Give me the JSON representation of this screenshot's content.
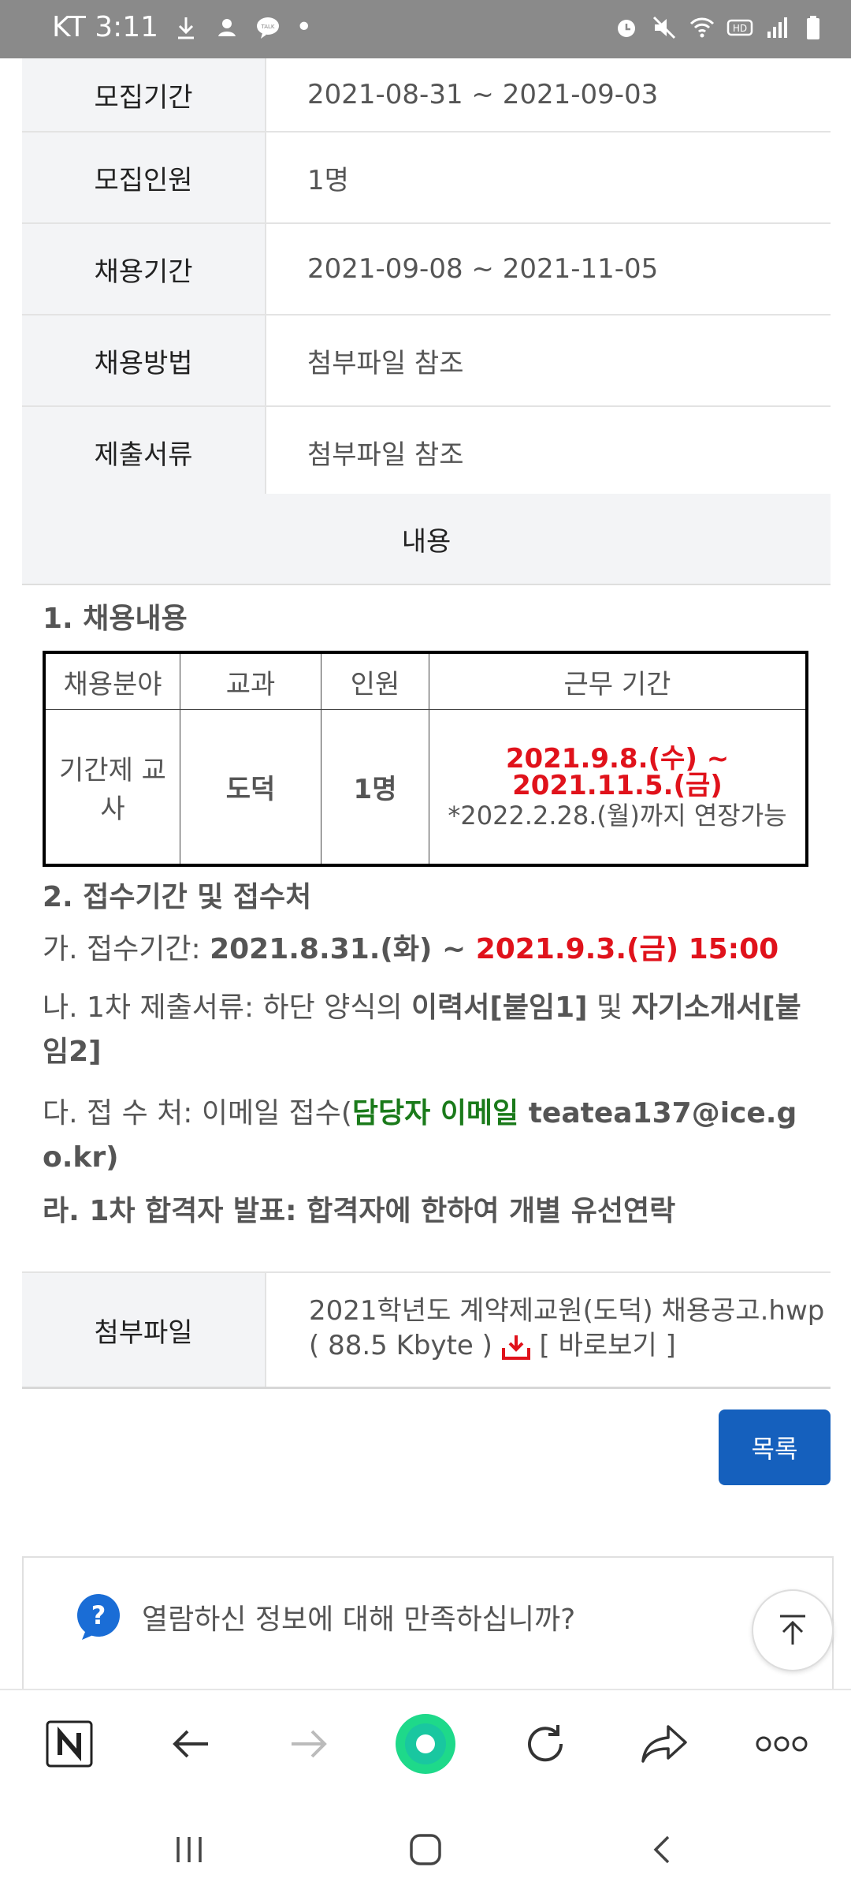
{
  "status_bar": {
    "carrier_time": "KT 3:11",
    "dot": "•"
  },
  "info_rows": [
    {
      "label": "모집기간",
      "value": "2021-08-31 ~ 2021-09-03"
    },
    {
      "label": "모집인원",
      "value": "1명"
    },
    {
      "label": "채용기간",
      "value": "2021-09-08 ~ 2021-11-05"
    },
    {
      "label": "채용방법",
      "value": "첨부파일 참조"
    },
    {
      "label": "제출서류",
      "value": "첨부파일 참조"
    }
  ],
  "content_header": "내용",
  "section1_title": "1. 채용내용",
  "job_table": {
    "headers": [
      "채용분야",
      "교과",
      "인원",
      "근무 기간"
    ],
    "field": "기간제 교사",
    "subject": "도덕",
    "count": "1명",
    "period_main": "2021.9.8.(수) ~ 2021.11.5.(금)",
    "period_note": "*2022.2.28.(월)까지 연장가능"
  },
  "section2_title": "2. 접수기간 및 접수처",
  "line_ga": {
    "prefix": "가. 접수기간: ",
    "start": "2021.8.31.(화) ~ ",
    "end": "2021.9.3.(금) 15:00"
  },
  "line_na": {
    "prefix": "나. 1차 제출서류: 하단 양식의 ",
    "doc1": "이력서[붙임1]",
    "mid": " 및 ",
    "doc2": "자기소개서[붙임2]"
  },
  "line_da": {
    "prefix": "다. 접 수 처: 이메일 접수(",
    "green": "담당자 이메일",
    "email": " teatea137@ice.go.kr",
    "suffix": ")"
  },
  "line_ra": "라. 1차 합격자 발표: 합격자에 한하여 개별 유선연락",
  "attachment": {
    "label": "첨부파일",
    "file_name": "2021학년도 계약제교원(도덕) 채용공고.hwp",
    "size": "( 88.5 Kbyte )",
    "preview": "[ 바로보기 ]"
  },
  "list_button": "목록",
  "survey_question": "열람하신 정보에 대해 만족하십니까?",
  "colors": {
    "accent": "#1560bd",
    "red": "#e0121b",
    "green": "#1a7a1a",
    "whale_green": "#1ed98a"
  },
  "icons": {
    "toolbar": [
      "naver-home-icon",
      "back-arrow-icon",
      "forward-arrow-icon",
      "whale-browser-icon",
      "refresh-icon",
      "share-icon",
      "more-icon"
    ],
    "nav": [
      "recent-apps-icon",
      "home-icon",
      "nav-back-icon"
    ]
  }
}
